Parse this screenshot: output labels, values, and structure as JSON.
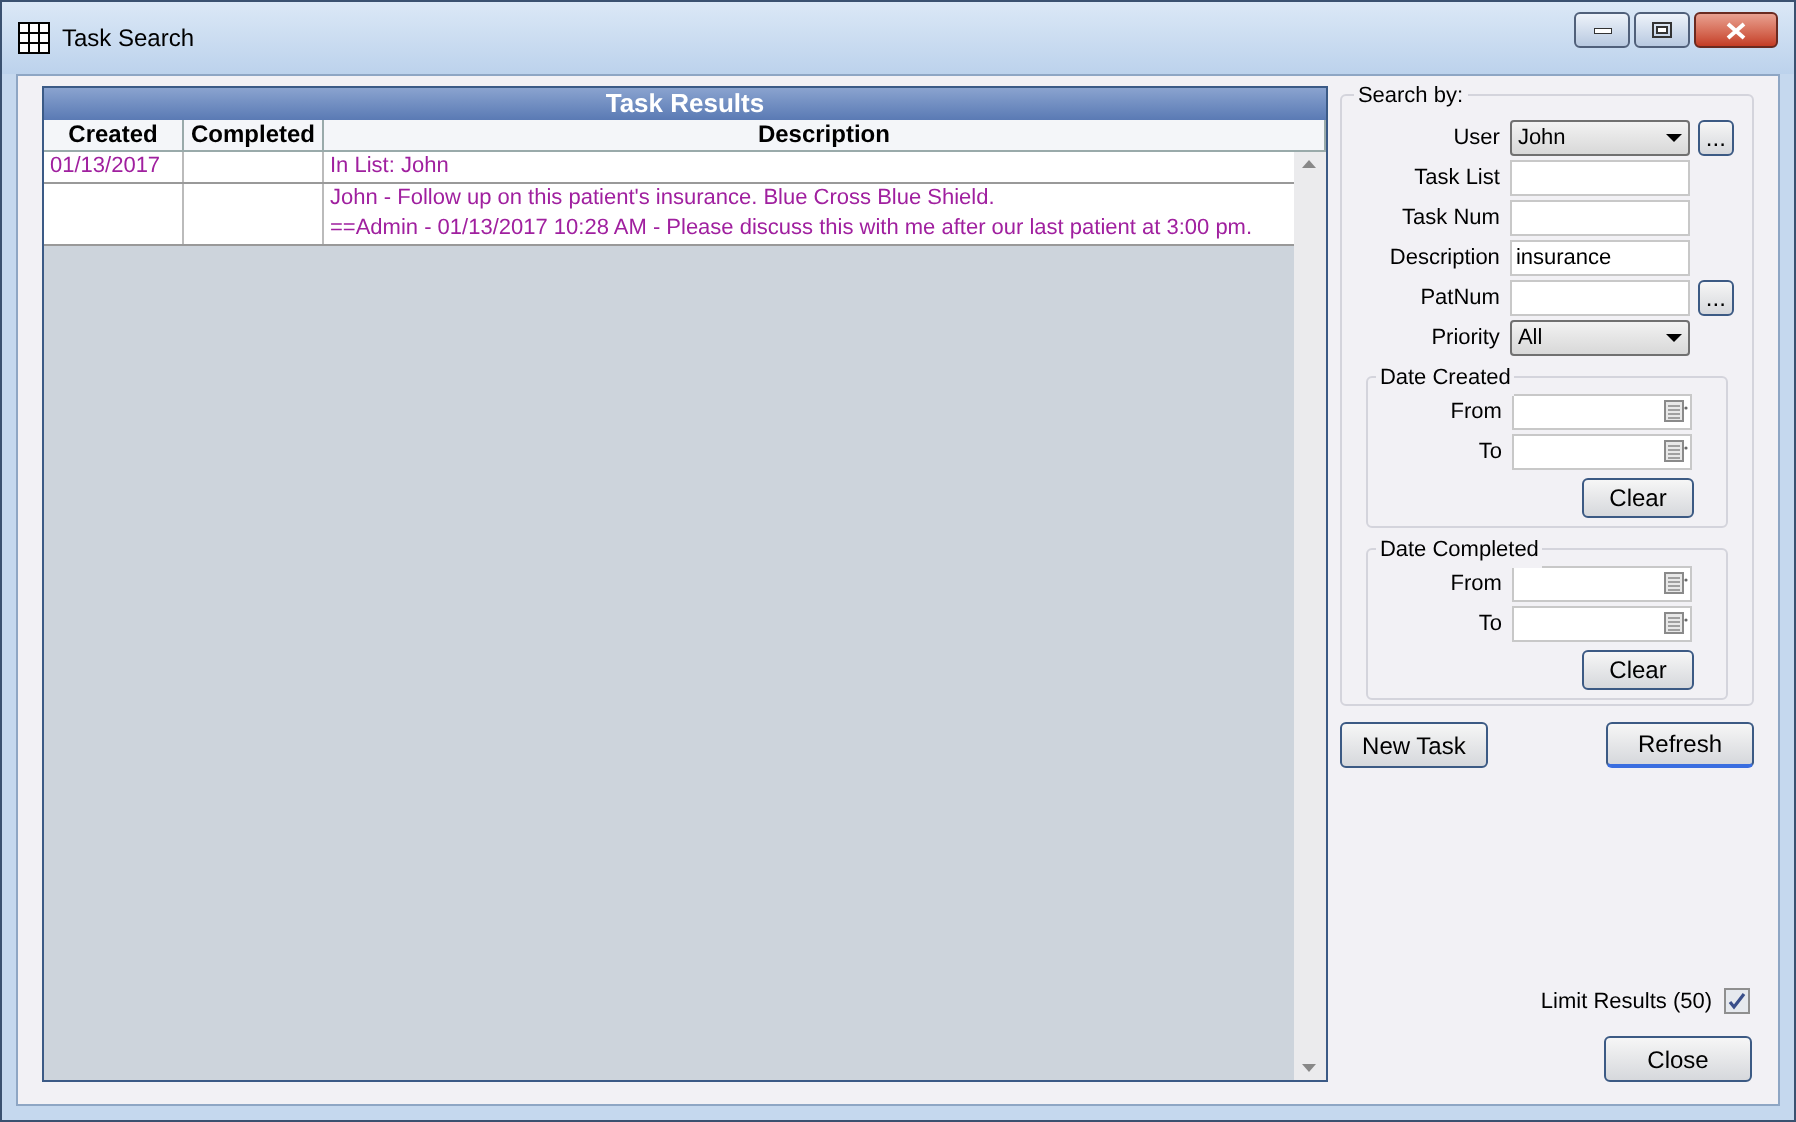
{
  "window": {
    "title": "Task Search"
  },
  "grid": {
    "title": "Task Results",
    "columns": [
      "Created",
      "Completed",
      "Description"
    ],
    "rows": [
      {
        "created": "01/13/2017",
        "description": [
          "In List: John"
        ]
      },
      {
        "description": [
          "John - Follow up on this patient's insurance. Blue Cross Blue Shield.",
          "==Admin - 01/13/2017 10:28 AM - Please discuss this with me after our last patient at 3:00 pm."
        ]
      }
    ]
  },
  "search": {
    "title": "Search by:",
    "fields": [
      {
        "label": "User",
        "kind": "dropdown",
        "value": "John",
        "browse": "..."
      },
      {
        "label": "Task List",
        "kind": "text"
      },
      {
        "label": "Task Num",
        "kind": "text"
      },
      {
        "label": "Description",
        "kind": "text",
        "value": "insurance"
      },
      {
        "label": "PatNum",
        "kind": "text",
        "browse": "..."
      },
      {
        "label": "Priority",
        "kind": "dropdown",
        "value": "All"
      }
    ],
    "date_groups": [
      {
        "title": "Date Created",
        "rows": [
          "From",
          "To"
        ],
        "clear": "Clear"
      },
      {
        "title": "Date Completed",
        "rows": [
          "From",
          "To"
        ],
        "clear": "Clear"
      }
    ]
  },
  "buttons": {
    "new_task": "New Task",
    "refresh": "Refresh",
    "close": "Close"
  },
  "limit_results": {
    "label": "Limit Results (50)",
    "checked": true
  }
}
